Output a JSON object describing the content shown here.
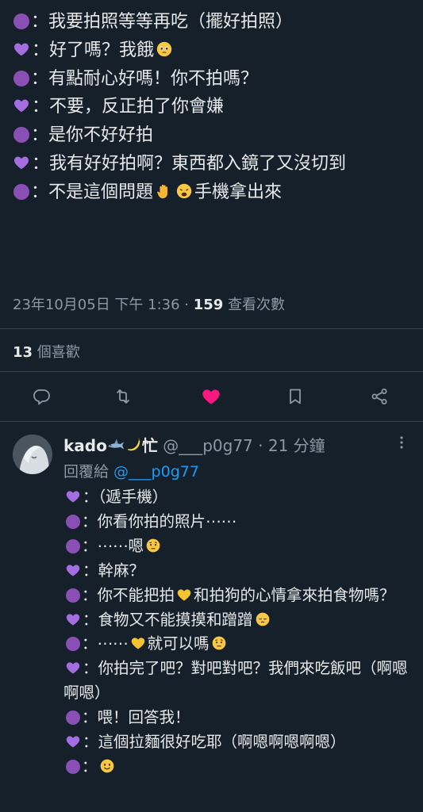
{
  "tweet": {
    "lines": [
      {
        "speaker": "purple",
        "text": "：我要拍照等等再吃（擺好拍照）"
      },
      {
        "speaker": "heart",
        "text": "：好了嗎？我餓",
        "emoji_after": "pleading"
      },
      {
        "speaker": "purple",
        "text": "：有點耐心好嗎！你不拍嗎？"
      },
      {
        "speaker": "heart",
        "text": "：不要，反正拍了你會嫌"
      },
      {
        "speaker": "purple",
        "text": "：是你不好好拍"
      },
      {
        "speaker": "heart",
        "text": "：我有好好拍啊？東西都入鏡了又沒切到"
      },
      {
        "speaker": "purple",
        "text": "：不是這個問題",
        "emoji_after": "hand-weary",
        "text_after": "手機拿出來"
      }
    ],
    "date": "23年10月05日 下午 1:36",
    "separator": " · ",
    "views_count": "159",
    "views_label": " 查看次數",
    "likes_count": "13",
    "likes_label": " 個喜歡"
  },
  "actions": {
    "reply_icon": "reply-icon",
    "retweet_icon": "retweet-icon",
    "like_icon": "heart-filled-icon",
    "bookmark_icon": "bookmark-icon",
    "share_icon": "share-icon",
    "like_color": "#f91880"
  },
  "reply": {
    "name": "kado",
    "name_suffix": "忙",
    "handle": "@___p0g77",
    "time": "· 21 分鐘",
    "reply_to_label": "回覆給 ",
    "reply_to_handle": "@___p0g77",
    "lines": [
      {
        "speaker": "heart",
        "text": "：（遞手機）"
      },
      {
        "speaker": "purple",
        "text": "：你看你拍的照片⋯⋯"
      },
      {
        "speaker": "purple",
        "text": "：⋯⋯嗯",
        "emoji_after": "raised-eyebrow"
      },
      {
        "speaker": "heart",
        "text": "：幹麻？"
      },
      {
        "speaker": "purple",
        "text": "：你不能把拍",
        "yellow_heart": true,
        "text_after": "和拍狗的心情拿來拍食物嗎？"
      },
      {
        "speaker": "heart",
        "text": "：食物又不能摸摸和蹭蹭",
        "emoji_after": "pensive"
      },
      {
        "speaker": "purple",
        "text": "：⋯⋯",
        "yellow_heart": true,
        "text_after": "就可以嗎",
        "emoji_after2": "raised-eyebrow"
      },
      {
        "speaker": "heart",
        "text": "：你拍完了吧？對吧對吧？我們來吃飯吧（啊嗯啊嗯）"
      },
      {
        "speaker": "purple",
        "text": "：喂！回答我！"
      },
      {
        "speaker": "heart",
        "text": "：這個拉麵很好吃耶（啊嗯啊嗯啊嗯）"
      },
      {
        "speaker": "purple",
        "text": "：",
        "emoji_after": "smile"
      }
    ]
  }
}
